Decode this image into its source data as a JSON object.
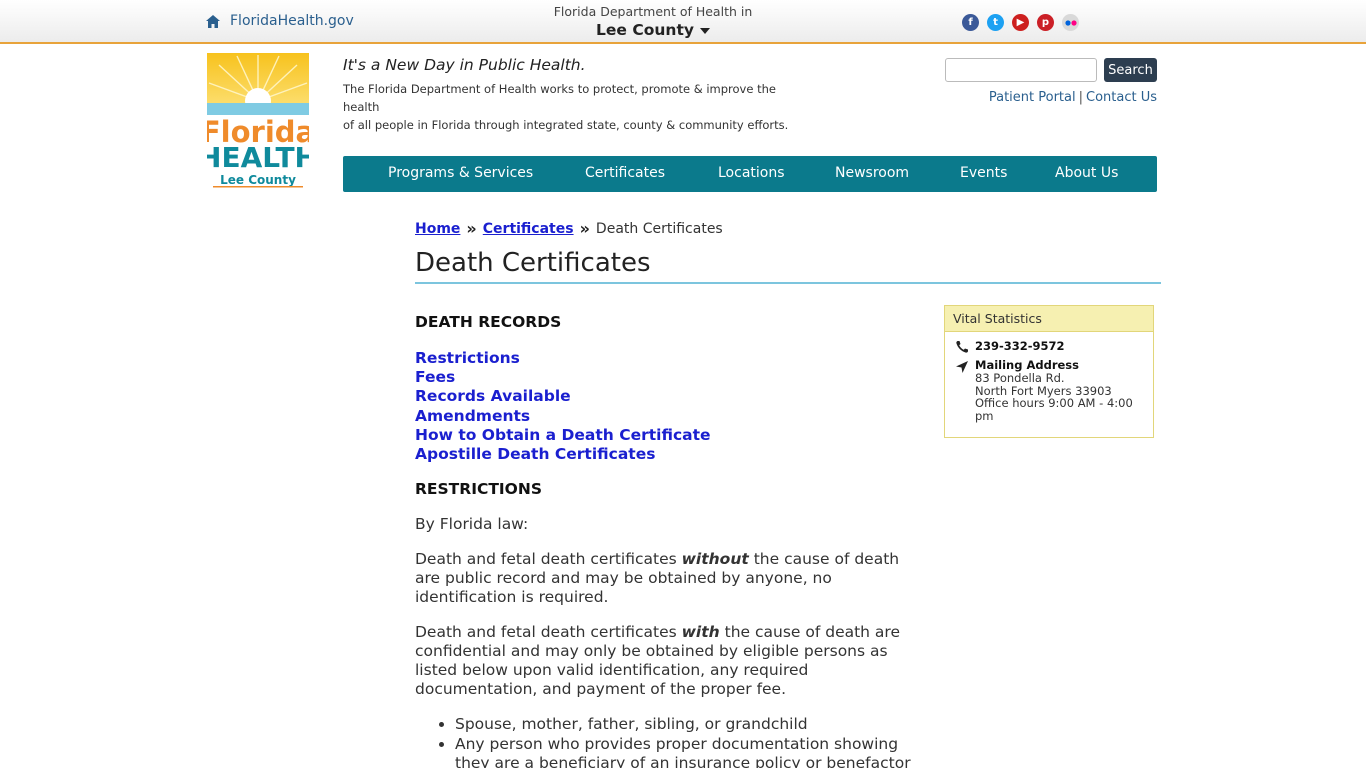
{
  "topbar": {
    "home_link": "FloridaHealth.gov",
    "county_prefix": "Florida Department of Health in",
    "county_name": "Lee County",
    "social_icons": [
      "facebook-icon",
      "twitter-icon",
      "youtube-icon",
      "pinterest-icon",
      "flickr-icon"
    ]
  },
  "header": {
    "logo_lines": [
      "Florida",
      "HEALTH",
      "Lee County"
    ],
    "tagline": "It's a New Day in Public Health.",
    "mission_line1": "The Florida Department of Health works to protect, promote & improve the health",
    "mission_line2": "of all people in Florida through integrated state, county & community efforts.",
    "search_placeholder": "",
    "search_button": "Search",
    "patient_portal": "Patient Portal",
    "separator": "|",
    "contact_us": "Contact Us"
  },
  "nav": {
    "items": [
      "Programs & Services",
      "Certificates",
      "Locations",
      "Newsroom",
      "Events",
      "About Us"
    ]
  },
  "breadcrumb": {
    "home": "Home",
    "certificates": "Certificates",
    "current": "Death Certificates"
  },
  "page": {
    "title": "Death Certificates",
    "death_records_heading": "DEATH RECORDS",
    "links": [
      "Restrictions",
      "Fees",
      "Records Available",
      "Amendments",
      "How to Obtain a Death Certificate",
      "Apostille Death Certificates"
    ],
    "restrictions_heading": "RESTRICTIONS",
    "by_law": "By Florida law:",
    "p1_start": "Death and fetal death certificates ",
    "p1_em": "without",
    "p1_end": " the cause of death are public record and may be obtained by anyone, no identification is required.",
    "p2_start": "Death and fetal death certificates ",
    "p2_em": "with",
    "p2_end": " the cause of death are confidential and may only be obtained by eligible persons as listed below upon valid identification, any required documentation, and payment of the proper fee.",
    "bullets": [
      "Spouse, mother, father, sibling, or grandchild",
      "Any person who provides proper documentation showing they are a beneficiary of an insurance policy or benefactor of"
    ]
  },
  "sidebar": {
    "heading": "Vital Statistics",
    "phone": "239-332-9572",
    "mailing_label": "Mailing Address",
    "address_line1": "83 Pondella Rd.",
    "address_line2": "North Fort Myers 33903",
    "hours_line1": "Office hours 9:00 AM - 4:00",
    "hours_line2": "pm"
  },
  "colors": {
    "nav_bg": "#0b7a8c",
    "link": "#1a1fcf",
    "topbar_border": "#e8a33b",
    "sidebar_head": "#f6f0b1"
  }
}
